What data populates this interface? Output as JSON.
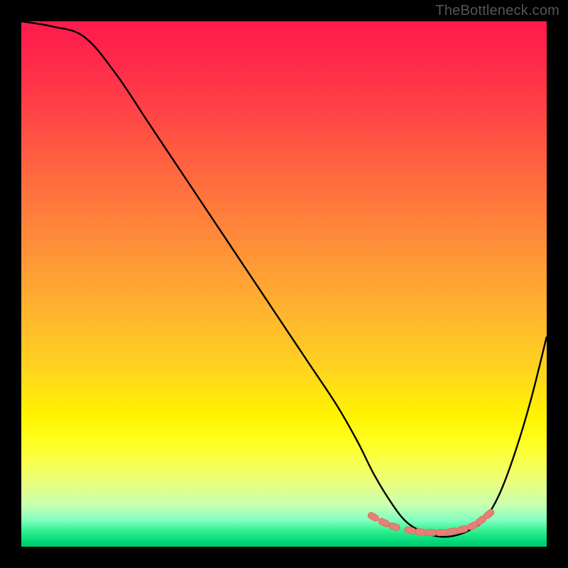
{
  "attribution": "TheBottleneck.com",
  "colors": {
    "frame": "#000000",
    "curve": "#000000",
    "marker_fill": "#e87f74",
    "marker_stroke": "#d66a5f",
    "gradient_top": "#ff1a4d",
    "gradient_bottom": "#00c86a"
  },
  "chart_data": {
    "type": "line",
    "title": "",
    "xlabel": "",
    "ylabel": "",
    "xlim": [
      0,
      100
    ],
    "ylim": [
      0,
      100
    ],
    "series": [
      {
        "name": "bottleneck-curve",
        "x": [
          0,
          6,
          12,
          18,
          24,
          30,
          36,
          42,
          48,
          54,
          60,
          64,
          67,
          70,
          73,
          76,
          79,
          82,
          85,
          88,
          91,
          94,
          97,
          100
        ],
        "values": [
          100,
          99,
          97,
          90,
          81,
          72,
          63,
          54,
          45,
          36,
          27,
          20,
          14,
          9,
          5,
          3,
          2,
          2,
          3,
          5,
          10,
          18,
          28,
          40
        ]
      }
    ],
    "markers": {
      "name": "optimal-range",
      "points": [
        {
          "x": 67,
          "y": 5.7
        },
        {
          "x": 69,
          "y": 4.6
        },
        {
          "x": 71,
          "y": 3.8
        },
        {
          "x": 74,
          "y": 3.1
        },
        {
          "x": 76,
          "y": 2.8
        },
        {
          "x": 78,
          "y": 2.7
        },
        {
          "x": 80,
          "y": 2.7
        },
        {
          "x": 82,
          "y": 2.9
        },
        {
          "x": 84,
          "y": 3.3
        },
        {
          "x": 86,
          "y": 4.0
        },
        {
          "x": 87.5,
          "y": 5.0
        },
        {
          "x": 89,
          "y": 6.2
        }
      ]
    }
  }
}
